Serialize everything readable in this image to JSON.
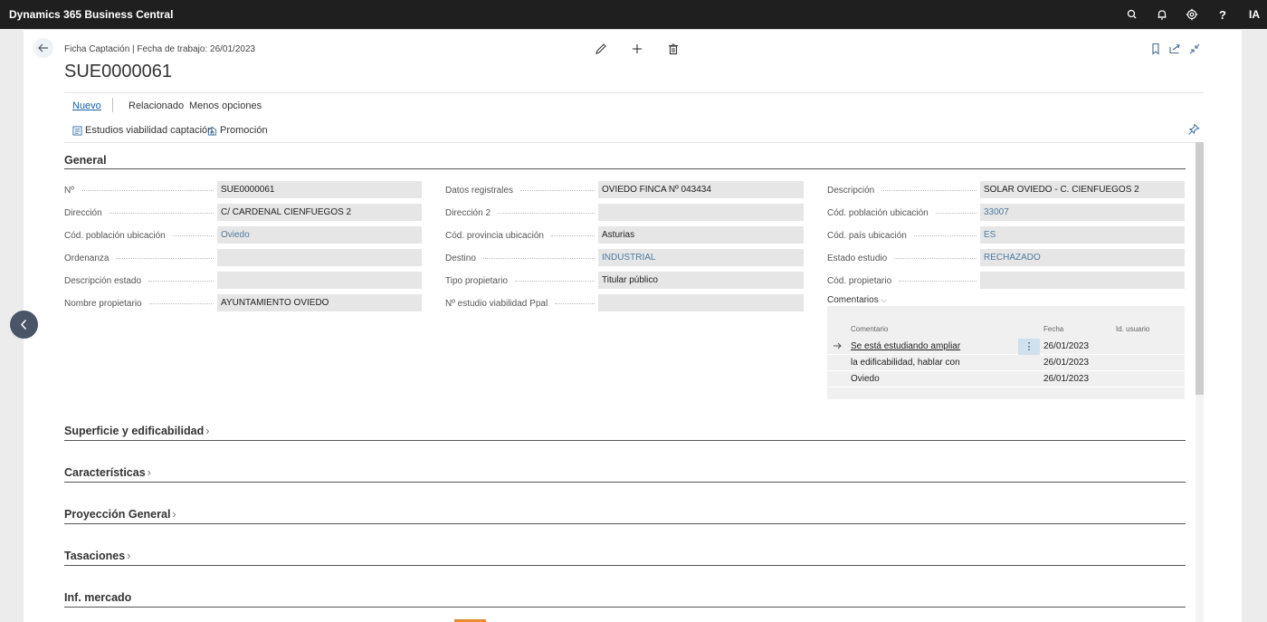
{
  "app": {
    "title": "Dynamics 365 Business Central",
    "user_initials": "IA"
  },
  "topbar_icons": [
    "search-icon",
    "bell-icon",
    "gear-icon",
    "help-icon"
  ],
  "header": {
    "breadcrumb": "Ficha Captación | Fecha de trabajo: 26/01/2023",
    "record_title": "SUE0000061"
  },
  "actions": {
    "tabs": [
      "Nuevo",
      "Relacionado",
      "Menos opciones"
    ],
    "promoted": [
      "Estudios viabilidad captación",
      "Promoción"
    ]
  },
  "general": {
    "title": "General",
    "col1": [
      {
        "label": "Nº",
        "value": "SUE0000061",
        "link": false
      },
      {
        "label": "Dirección",
        "value": "C/ CARDENAL CIENFUEGOS 2",
        "link": false
      },
      {
        "label": "Cód. población ubicación",
        "value": "Oviedo",
        "link": true
      },
      {
        "label": "Ordenanza",
        "value": "",
        "link": false
      },
      {
        "label": "Descripción estado",
        "value": "",
        "link": false
      },
      {
        "label": "Nombre propietario",
        "value": "AYUNTAMIENTO OVIEDO",
        "link": false
      }
    ],
    "col2": [
      {
        "label": "Datos registrales",
        "value": "OVIEDO FINCA Nº 043434",
        "link": false
      },
      {
        "label": "Dirección 2",
        "value": "",
        "link": false
      },
      {
        "label": "Cód. provincia ubicación",
        "value": "Asturias",
        "link": false
      },
      {
        "label": "Destino",
        "value": "INDUSTRIAL",
        "link": true
      },
      {
        "label": "Tipo propietario",
        "value": "Titular público",
        "link": false
      },
      {
        "label": "Nº estudio viabilidad Ppal",
        "value": "",
        "link": false
      }
    ],
    "col3": [
      {
        "label": "Descripción",
        "value": "SOLAR OVIEDO - C. CIENFUEGOS 2",
        "link": false
      },
      {
        "label": "Cód. población ubicación",
        "value": "33007",
        "link": true
      },
      {
        "label": "Cód. país ubicación",
        "value": "ES",
        "link": true
      },
      {
        "label": "Estado estudio",
        "value": "RECHAZADO",
        "link": true
      },
      {
        "label": "Cód. propietario",
        "value": "",
        "link": false
      }
    ]
  },
  "comments": {
    "label": "Comentarios",
    "headers": {
      "comment": "Comentario",
      "date": "Fecha",
      "user": "Id. usuario"
    },
    "rows": [
      {
        "comment": "Se está estudiando ampliar",
        "date": "26/01/2023",
        "user": ""
      },
      {
        "comment": "la edificabilidad, hablar con",
        "date": "26/01/2023",
        "user": ""
      },
      {
        "comment": "Oviedo",
        "date": "26/01/2023",
        "user": ""
      }
    ]
  },
  "sections": [
    "Superficie y edificabilidad",
    "Características",
    "Proyección General",
    "Tasaciones",
    "Inf. mercado"
  ],
  "colors": {
    "topbar": "#1f1f1f",
    "accent": "#1a5fa8",
    "field_bg": "#e6e6e6"
  }
}
